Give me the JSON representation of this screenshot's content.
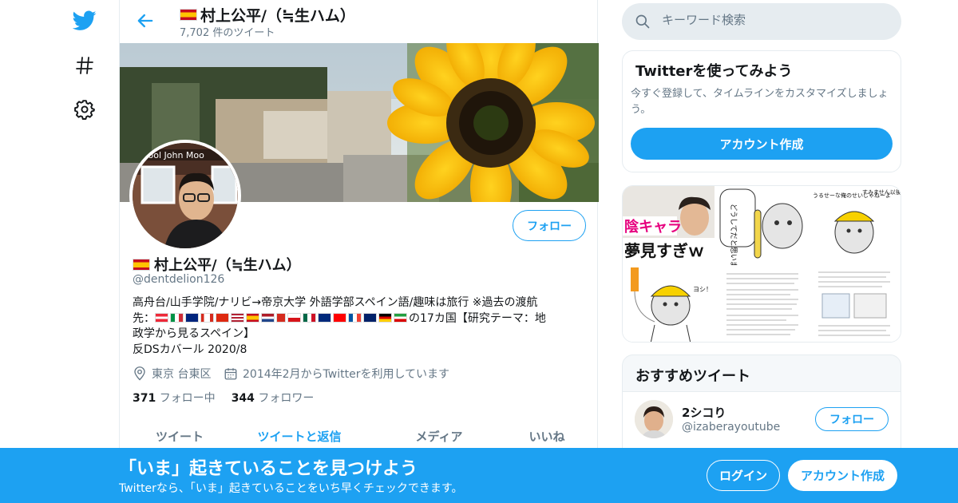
{
  "nav": {
    "icons": [
      "twitter-bird-icon",
      "hashtag-icon",
      "gear-icon"
    ]
  },
  "header": {
    "title": "村上公平/（≒生ハム）",
    "tweet_count": "7,702 件のツイート"
  },
  "profile": {
    "name": "村上公平/（≒生ハム）",
    "handle": "@dentdelion126",
    "follow_label": "フォロー",
    "bio_line1": "高舟台/山手学院/ナリビ→帝京大学  外語学部スペイン語/趣味は旅行   ※過去の渡航",
    "bio_line2_prefix": "先：",
    "bio_line2_suffix": "の17カ国【研究テーマ：地",
    "bio_line3": "政学から見るスペイン】",
    "bio_line4": "反DSカバール   2020/8",
    "location": "東京 台東区",
    "joined": "2014年2月からTwitterを利用しています",
    "following_count": "371",
    "following_label": "フォロー中",
    "followers_count": "344",
    "followers_label": "フォロワー"
  },
  "tabs": [
    {
      "label": "ツイート",
      "active": false
    },
    {
      "label": "ツイートと返信",
      "active": true
    },
    {
      "label": "メディア",
      "active": false
    },
    {
      "label": "いいね",
      "active": false
    }
  ],
  "search": {
    "placeholder": "キーワード検索"
  },
  "signup_card": {
    "title": "Twitterを使ってみよう",
    "text": "今すぐ登録して、タイムラインをカスタマイズしましょう。",
    "button": "アカウント作成"
  },
  "media": {
    "caption_top": "陰キャラ",
    "caption_bottom": "夢見すぎｗ",
    "bubble1": "どうしてだと思いますか？",
    "bubble2": "うるせーな俺のせいじゃねーよ",
    "bubble3": "すみません以後気をつけます",
    "bubble4": "ヨシ！"
  },
  "recommended": {
    "title": "おすすめツイート",
    "user_name": "2シコり",
    "user_handle": "@izaberayoutube",
    "follow_label": "フォロー"
  },
  "bottom_bar": {
    "title": "「いま」起きていることを見つけよう",
    "subtitle": "Twitterなら、「いま」起きていることをいち早くチェックできます。",
    "login": "ログイン",
    "signup": "アカウント作成"
  },
  "colors": {
    "accent": "#1da1f2",
    "text": "#14171a",
    "secondary": "#657786",
    "border": "#e6ecf0"
  }
}
